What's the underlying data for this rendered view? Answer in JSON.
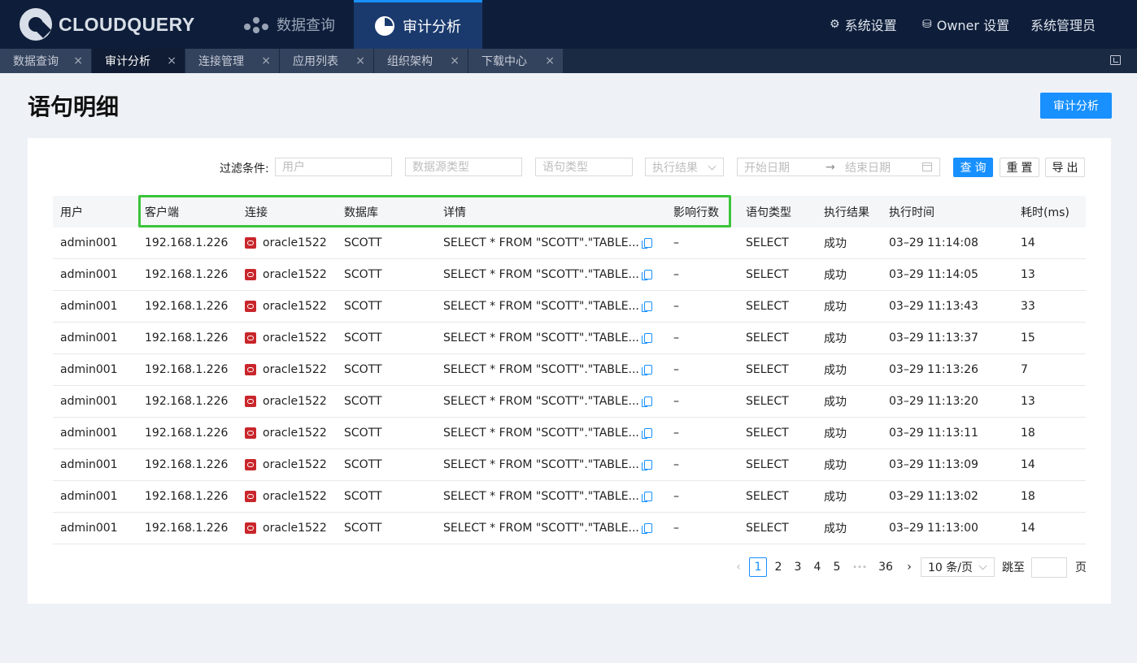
{
  "brand": {
    "name": "CLOUDQUERY"
  },
  "nav": {
    "query": "数据查询",
    "audit": "审计分析",
    "system_settings": "系统设置",
    "owner_settings": "Owner 设置",
    "admin": "系统管理员"
  },
  "tabs": [
    {
      "label": "数据查询"
    },
    {
      "label": "审计分析"
    },
    {
      "label": "连接管理"
    },
    {
      "label": "应用列表"
    },
    {
      "label": "组织架构"
    },
    {
      "label": "下载中心"
    }
  ],
  "tab_close": "×",
  "page": {
    "title": "语句明细",
    "audit_button": "审计分析"
  },
  "filter": {
    "label": "过滤条件:",
    "user_placeholder": "用户",
    "dbtype_placeholder": "数据源类型",
    "stmt_placeholder": "语句类型",
    "result_placeholder": "执行结果",
    "start_placeholder": "开始日期",
    "arrow": "→",
    "end_placeholder": "结束日期",
    "query_button": "查询",
    "reset_button": "重置",
    "export_button": "导出"
  },
  "table": {
    "columns": [
      "用户",
      "客户端",
      "连接",
      "数据库",
      "详情",
      "影响行数",
      "语句类型",
      "执行结果",
      "执行时间",
      "耗时(ms)"
    ],
    "rows": [
      {
        "user": "admin001",
        "client": "192.168.1.226",
        "conn": "oracle1522",
        "db": "SCOTT",
        "detail": "SELECT * FROM \"SCOTT\".\"TABLE...",
        "affected": "–",
        "stmt": "SELECT",
        "result": "成功",
        "time": "03–29 11:14:08",
        "ms": "14"
      },
      {
        "user": "admin001",
        "client": "192.168.1.226",
        "conn": "oracle1522",
        "db": "SCOTT",
        "detail": "SELECT * FROM \"SCOTT\".\"TABLE...",
        "affected": "–",
        "stmt": "SELECT",
        "result": "成功",
        "time": "03–29 11:14:05",
        "ms": "13"
      },
      {
        "user": "admin001",
        "client": "192.168.1.226",
        "conn": "oracle1522",
        "db": "SCOTT",
        "detail": "SELECT * FROM \"SCOTT\".\"TABLE...",
        "affected": "–",
        "stmt": "SELECT",
        "result": "成功",
        "time": "03–29 11:13:43",
        "ms": "33"
      },
      {
        "user": "admin001",
        "client": "192.168.1.226",
        "conn": "oracle1522",
        "db": "SCOTT",
        "detail": "SELECT * FROM \"SCOTT\".\"TABLE...",
        "affected": "–",
        "stmt": "SELECT",
        "result": "成功",
        "time": "03–29 11:13:37",
        "ms": "15"
      },
      {
        "user": "admin001",
        "client": "192.168.1.226",
        "conn": "oracle1522",
        "db": "SCOTT",
        "detail": "SELECT * FROM \"SCOTT\".\"TABLE...",
        "affected": "–",
        "stmt": "SELECT",
        "result": "成功",
        "time": "03–29 11:13:26",
        "ms": "7"
      },
      {
        "user": "admin001",
        "client": "192.168.1.226",
        "conn": "oracle1522",
        "db": "SCOTT",
        "detail": "SELECT * FROM \"SCOTT\".\"TABLE...",
        "affected": "–",
        "stmt": "SELECT",
        "result": "成功",
        "time": "03–29 11:13:20",
        "ms": "13"
      },
      {
        "user": "admin001",
        "client": "192.168.1.226",
        "conn": "oracle1522",
        "db": "SCOTT",
        "detail": "SELECT * FROM \"SCOTT\".\"TABLE...",
        "affected": "–",
        "stmt": "SELECT",
        "result": "成功",
        "time": "03–29 11:13:11",
        "ms": "18"
      },
      {
        "user": "admin001",
        "client": "192.168.1.226",
        "conn": "oracle1522",
        "db": "SCOTT",
        "detail": "SELECT * FROM \"SCOTT\".\"TABLE...",
        "affected": "–",
        "stmt": "SELECT",
        "result": "成功",
        "time": "03–29 11:13:09",
        "ms": "14"
      },
      {
        "user": "admin001",
        "client": "192.168.1.226",
        "conn": "oracle1522",
        "db": "SCOTT",
        "detail": "SELECT * FROM \"SCOTT\".\"TABLE...",
        "affected": "–",
        "stmt": "SELECT",
        "result": "成功",
        "time": "03–29 11:13:02",
        "ms": "18"
      },
      {
        "user": "admin001",
        "client": "192.168.1.226",
        "conn": "oracle1522",
        "db": "SCOTT",
        "detail": "SELECT * FROM \"SCOTT\".\"TABLE...",
        "affected": "–",
        "stmt": "SELECT",
        "result": "成功",
        "time": "03–29 11:13:00",
        "ms": "14"
      }
    ]
  },
  "pagination": {
    "prev": "‹",
    "pages": [
      "1",
      "2",
      "3",
      "4",
      "5"
    ],
    "ellipsis": "•••",
    "last": "36",
    "next": "›",
    "page_size": "10 条/页",
    "jump_label": "跳至",
    "page_suffix": "页"
  },
  "colors": {
    "nav_bg": "#0e1e3a",
    "accent": "#1890ff",
    "highlight": "#3ac43a",
    "oracle": "#c9262b"
  }
}
